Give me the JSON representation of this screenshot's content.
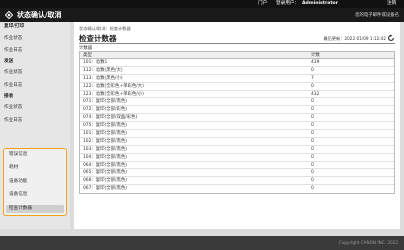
{
  "topbar": {
    "portal": "门户",
    "login_user_label": "登录用户：",
    "user_name": "Administrator",
    "logout": "注销"
  },
  "header": {
    "app_title": "状态确认/取消",
    "device_info": "您的电子邮件或设备名"
  },
  "sidebar": {
    "sections": [
      {
        "title": "复印/打印",
        "items": [
          "作业状态",
          "作业日志"
        ]
      },
      {
        "title": "发送",
        "items": [
          "作业状态",
          "作业日志"
        ]
      },
      {
        "title": "接收",
        "items": [
          "作业状态",
          "作业日志"
        ]
      }
    ],
    "group_items": [
      "错误信息",
      "耗材",
      "设备功能",
      "设备信息",
      "检查计数器"
    ]
  },
  "content": {
    "breadcrumb": "状态确认/取消：检查计数器",
    "title": "检查计数器",
    "updated": "最后更新：2022 01/09 1:12:42",
    "section_label": "计数器",
    "columns": [
      "类型",
      "计数"
    ],
    "rows": [
      [
        "101：总数1",
        "439"
      ],
      [
        "112：总数(黑色/大)",
        "0"
      ],
      [
        "113：总数(黑色/小)",
        "7"
      ],
      [
        "122：总数(全彩色+单彩色/大)",
        "0"
      ],
      [
        "123：总数(全彩色+单彩色/小)",
        "432"
      ],
      [
        "071：复印(全部/黑色)",
        "0"
      ],
      [
        "072：复印(全部/彩色)",
        "0"
      ],
      [
        "074：复印(全部/双面/彩色)",
        "0"
      ],
      [
        "075：复印(全部/黑色)",
        "0"
      ],
      [
        "101：复印(全部/黑色)",
        "0"
      ],
      [
        "102：复印(全部/黑色)",
        "0"
      ],
      [
        "103：复印(全部/黑色)",
        "0"
      ],
      [
        "104：复印(全部/黑色)",
        "0"
      ],
      [
        "064：复印(全部/黑色)",
        "0"
      ],
      [
        "065：复印(全部/黑色)",
        "0"
      ],
      [
        "066：复印(全部/黑色)",
        "0"
      ],
      [
        "067：复印(全部/黑色)",
        "0"
      ]
    ],
    "top_arrow": "▲"
  },
  "footer": {
    "copyright": "Copyright CANON INC. 2022"
  },
  "colors": {
    "accent": "#f2a21a",
    "topbar": "#111111",
    "header": "#1a1a1a",
    "sidebar": "#e6e6e6",
    "footer": "#3a3a3a"
  }
}
